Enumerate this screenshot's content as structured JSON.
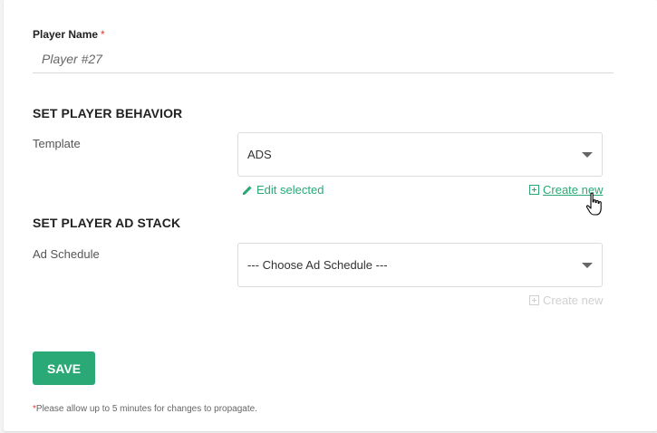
{
  "form": {
    "player_name_label": "Player Name",
    "required_mark": "*",
    "player_name_placeholder": "Player #27",
    "player_name_value": ""
  },
  "behavior": {
    "section_title": "SET PLAYER BEHAVIOR",
    "template_label": "Template",
    "template_selected": "ADS",
    "edit_selected_label": "Edit selected",
    "create_new_label": "Create new"
  },
  "ad_stack": {
    "section_title": "SET PLAYER AD STACK",
    "schedule_label": "Ad Schedule",
    "schedule_selected": "--- Choose Ad Schedule ---",
    "create_new_label": "Create new"
  },
  "actions": {
    "save_label": "SAVE"
  },
  "footer": {
    "note_star": "*",
    "note_text": "Please allow up to 5 minutes for changes to propagate."
  },
  "colors": {
    "accent": "#2aa876",
    "required": "#e53935",
    "disabled": "#d0d0d0"
  },
  "icons": {
    "edit": "pencil-icon",
    "create": "plus-square-icon",
    "dropdown": "chevron-down-icon",
    "cursor": "hand-pointer-cursor-icon"
  }
}
